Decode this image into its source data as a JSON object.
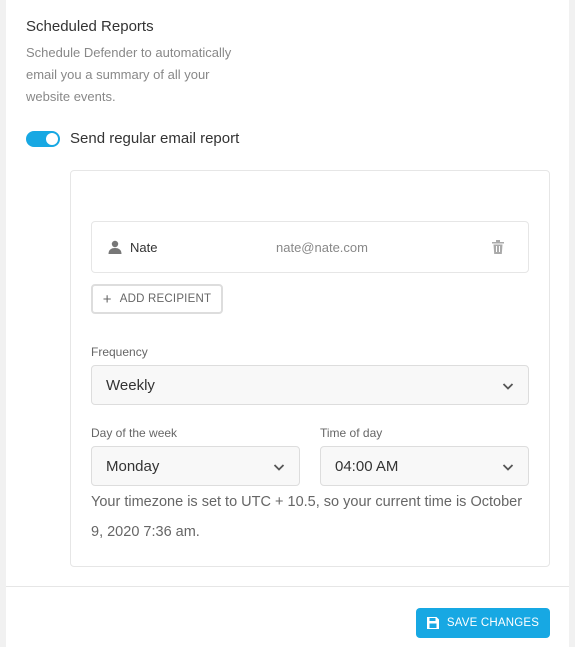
{
  "section": {
    "title": "Scheduled Reports",
    "description": "Schedule Defender to automatically email you a summary of all your website events."
  },
  "toggle": {
    "label": "Send regular email report",
    "enabled": true
  },
  "recipients": [
    {
      "name": "Nate",
      "email": "nate@nate.com"
    }
  ],
  "add_recipient_label": "ADD RECIPIENT",
  "frequency": {
    "label": "Frequency",
    "value": "Weekly"
  },
  "day_of_week": {
    "label": "Day of the week",
    "value": "Monday"
  },
  "time_of_day": {
    "label": "Time of day",
    "value": "04:00 AM"
  },
  "timezone_text": "Your timezone is set to UTC + 10.5, so your current time is October 9, 2020 7:36 am.",
  "save_label": "SAVE CHANGES",
  "colors": {
    "accent": "#17a8e3",
    "text": "#333333",
    "muted": "#888888",
    "border": "#dddddd"
  }
}
